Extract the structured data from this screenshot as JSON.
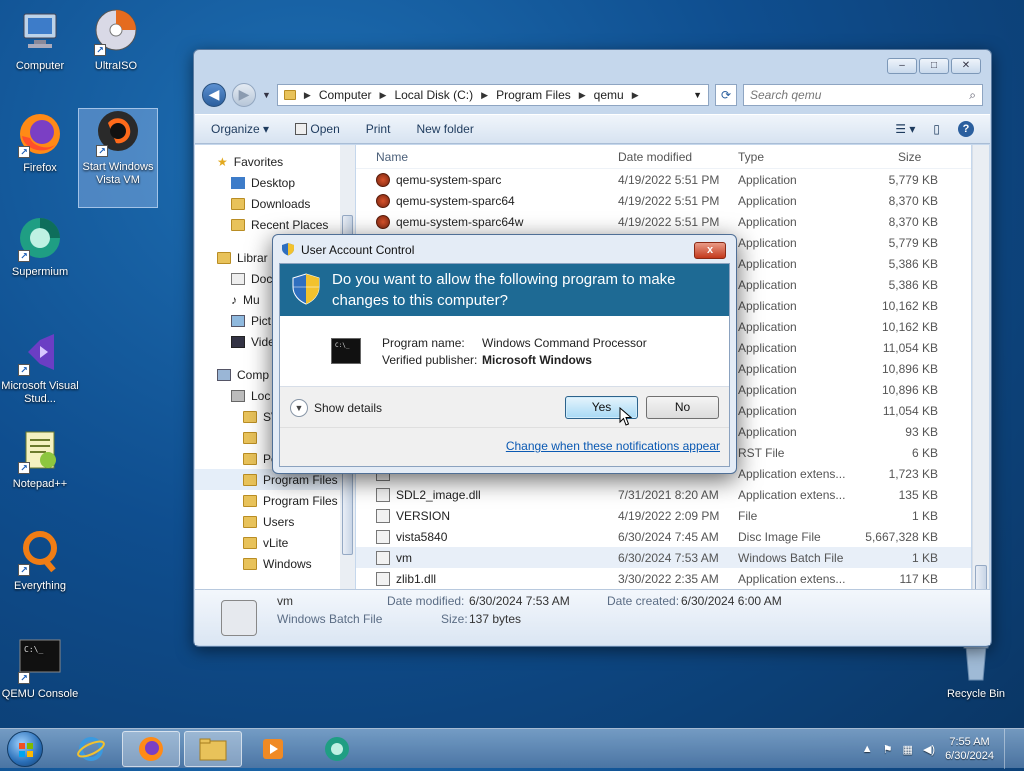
{
  "desktop": {
    "icons": [
      {
        "label": "Computer"
      },
      {
        "label": "UltraISO"
      },
      {
        "label": "Firefox"
      },
      {
        "label": "Start Windows Vista VM"
      },
      {
        "label": "Supermium"
      },
      {
        "label": "Microsoft Visual Stud..."
      },
      {
        "label": "Notepad++"
      },
      {
        "label": "Everything"
      },
      {
        "label": "QEMU Console"
      },
      {
        "label": "Recycle Bin"
      }
    ]
  },
  "explorer": {
    "address": [
      "Computer",
      "Local Disk (C:)",
      "Program Files",
      "qemu"
    ],
    "search_placeholder": "Search qemu",
    "toolbar": {
      "organize": "Organize",
      "open": "Open",
      "print": "Print",
      "new_folder": "New folder"
    },
    "nav": {
      "favorites": "Favorites",
      "desktop": "Desktop",
      "downloads": "Downloads",
      "recent": "Recent Places",
      "libraries": "Librar",
      "documents": "Doc",
      "music": "Mu",
      "pictures": "Pict",
      "videos": "Vide",
      "computer": "Comp",
      "local": "Loc",
      "sv": "SV",
      "perflogs": "PerfLogs",
      "program_files": "Program Files",
      "program_files_x86": "Program Files (",
      "users": "Users",
      "vlite": "vLite",
      "windows": "Windows"
    },
    "columns": {
      "name": "Name",
      "date": "Date modified",
      "type": "Type",
      "size": "Size"
    },
    "files": [
      {
        "name": "qemu-system-sparc",
        "date": "4/19/2022 5:51 PM",
        "type": "Application",
        "size": "5,779 KB"
      },
      {
        "name": "qemu-system-sparc64",
        "date": "4/19/2022 5:51 PM",
        "type": "Application",
        "size": "8,370 KB"
      },
      {
        "name": "qemu-system-sparc64w",
        "date": "4/19/2022 5:51 PM",
        "type": "Application",
        "size": "8,370 KB"
      },
      {
        "name": "",
        "date": "",
        "type": "Application",
        "size": "5,779 KB"
      },
      {
        "name": "",
        "date": "",
        "type": "Application",
        "size": "5,386 KB"
      },
      {
        "name": "",
        "date": "",
        "type": "Application",
        "size": "5,386 KB"
      },
      {
        "name": "",
        "date": "",
        "type": "Application",
        "size": "10,162 KB"
      },
      {
        "name": "",
        "date": "",
        "type": "Application",
        "size": "10,162 KB"
      },
      {
        "name": "",
        "date": "",
        "type": "Application",
        "size": "11,054 KB"
      },
      {
        "name": "",
        "date": "",
        "type": "Application",
        "size": "10,896 KB"
      },
      {
        "name": "",
        "date": "",
        "type": "Application",
        "size": "10,896 KB"
      },
      {
        "name": "",
        "date": "",
        "type": "Application",
        "size": "11,054 KB"
      },
      {
        "name": "",
        "date": "",
        "type": "Application",
        "size": "93 KB"
      },
      {
        "name": "",
        "date": "",
        "type": "RST File",
        "size": "6 KB"
      },
      {
        "name": "",
        "date": "",
        "type": "Application extens...",
        "size": "1,723 KB"
      },
      {
        "name": "SDL2_image.dll",
        "date": "7/31/2021 8:20 AM",
        "type": "Application extens...",
        "size": "135 KB"
      },
      {
        "name": "VERSION",
        "date": "4/19/2022 2:09 PM",
        "type": "File",
        "size": "1 KB"
      },
      {
        "name": "vista5840",
        "date": "6/30/2024 7:45 AM",
        "type": "Disc Image File",
        "size": "5,667,328 KB"
      },
      {
        "name": "vm",
        "date": "6/30/2024 7:53 AM",
        "type": "Windows Batch File",
        "size": "1 KB"
      },
      {
        "name": "zlib1.dll",
        "date": "3/30/2022 2:35 AM",
        "type": "Application extens...",
        "size": "117 KB"
      }
    ],
    "details": {
      "name": "vm",
      "type": "Windows Batch File",
      "date_modified_label": "Date modified:",
      "date_modified": "6/30/2024 7:53 AM",
      "date_created_label": "Date created:",
      "date_created": "6/30/2024 6:00 AM",
      "size_label": "Size:",
      "size": "137 bytes"
    }
  },
  "uac": {
    "title": "User Account Control",
    "question": "Do you want to allow the following program to make changes to this computer?",
    "program_name_label": "Program name:",
    "program_name": "Windows Command Processor",
    "publisher_label": "Verified publisher:",
    "publisher": "Microsoft Windows",
    "show_details": "Show details",
    "yes": "Yes",
    "no": "No",
    "change_link": "Change when these notifications appear",
    "close": "x"
  },
  "taskbar": {
    "time": "7:55 AM",
    "date": "6/30/2024"
  }
}
